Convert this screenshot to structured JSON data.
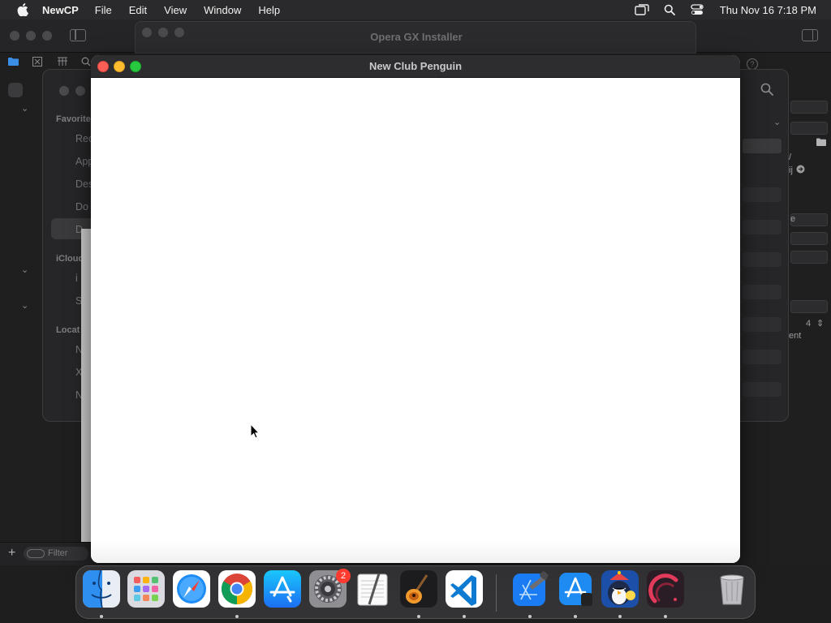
{
  "menubar": {
    "app_name": "NewCP",
    "items": [
      "File",
      "Edit",
      "View",
      "Window",
      "Help"
    ],
    "clock": "Thu Nov 16  7:18 PM"
  },
  "background_window": {
    "title": "Opera GX Installer",
    "sidebar": {
      "favorites_label": "Favorite",
      "favorites": [
        "Rec",
        "App",
        "Des",
        "Do",
        "D"
      ],
      "icloud_label": "iCloud",
      "icloud_items": [
        "i",
        "S"
      ],
      "locations_label": "Locat",
      "locations": [
        "N",
        "X",
        "N"
      ]
    },
    "filter_placeholder": "Filter",
    "right_panel": {
      "slash_text": "/",
      "item_text": "ij",
      "select_text": "e",
      "stepper_value": "4",
      "tail_text": "ent"
    }
  },
  "main_window": {
    "title": "New Club Penguin"
  },
  "dock": {
    "apps": [
      {
        "name": "Finder",
        "running": true
      },
      {
        "name": "Launchpad",
        "running": false
      },
      {
        "name": "Safari",
        "running": false
      },
      {
        "name": "Google Chrome",
        "running": true
      },
      {
        "name": "App Store",
        "running": false
      },
      {
        "name": "System Settings",
        "running": false,
        "badge": "2"
      },
      {
        "name": "TextEdit",
        "running": false
      },
      {
        "name": "GarageBand",
        "running": true
      },
      {
        "name": "Visual Studio Code",
        "running": true
      },
      {
        "name": "Xcode",
        "running": true
      },
      {
        "name": "Simulator",
        "running": true
      },
      {
        "name": "New Club Penguin",
        "running": true
      },
      {
        "name": "Instruments",
        "running": true
      },
      {
        "name": "Trash",
        "running": false
      }
    ]
  },
  "colors": {
    "close": "#ff5f57",
    "minimize": "#febc2e",
    "maximize": "#28c840",
    "badge": "#ff3b30"
  }
}
